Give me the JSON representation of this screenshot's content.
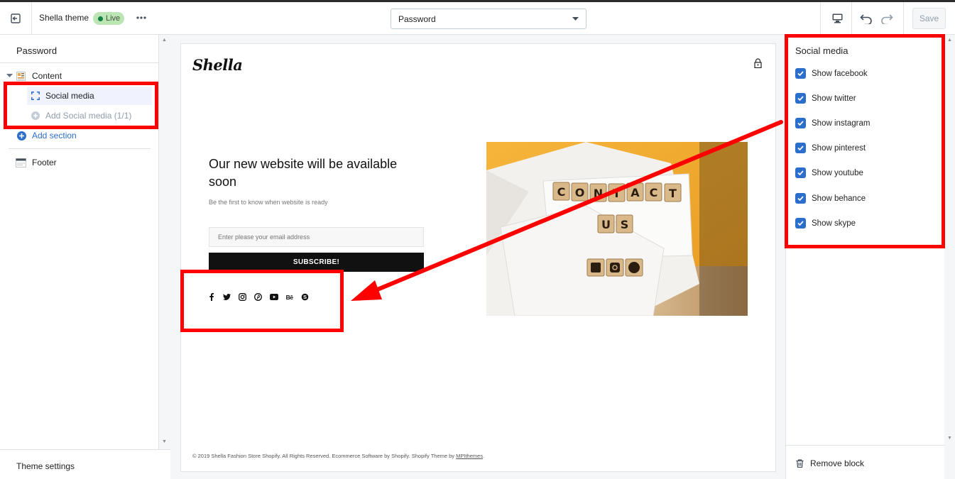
{
  "topbar": {
    "theme_name": "Shella theme",
    "live_label": "Live",
    "page_select": "Password",
    "save_label": "Save"
  },
  "left": {
    "title": "Password",
    "content_label": "Content",
    "social_media_label": "Social media",
    "add_social_label": "Add Social media (1/1)",
    "add_section_label": "Add section",
    "footer_label": "Footer",
    "theme_settings_label": "Theme settings"
  },
  "preview": {
    "logo": "Shella",
    "headline": "Our new website will be available soon",
    "subline": "Be the first to know when website is ready",
    "email_placeholder": "Enter please your email address",
    "subscribe_label": "SUBSCRIBE!",
    "social_icons": [
      "facebook-icon",
      "twitter-icon",
      "instagram-icon",
      "pinterest-icon",
      "youtube-icon",
      "behance-icon",
      "skype-icon"
    ],
    "footer_text": "© 2019 Shella Fashion Store Shopify. All Rights Reserved. Ecommerce Software by Shopify. Shopify Theme by ",
    "footer_link": "MPIthemes",
    "footer_end": ".",
    "photo_tiles_row1": [
      "C",
      "O",
      "N",
      "T",
      "A",
      "C",
      "T"
    ],
    "photo_tiles_row2": [
      "U",
      "S"
    ]
  },
  "right": {
    "title": "Social media",
    "checkboxes": [
      {
        "label": "Show facebook",
        "checked": true
      },
      {
        "label": "Show twitter",
        "checked": true
      },
      {
        "label": "Show instagram",
        "checked": true
      },
      {
        "label": "Show pinterest",
        "checked": true
      },
      {
        "label": "Show youtube",
        "checked": true
      },
      {
        "label": "Show behance",
        "checked": true
      },
      {
        "label": "Show skype",
        "checked": true
      }
    ],
    "remove_block_label": "Remove block"
  },
  "colors": {
    "accent": "#2c6ecb",
    "live_badge": "#bbe5b3",
    "annotation": "#ff0000"
  }
}
